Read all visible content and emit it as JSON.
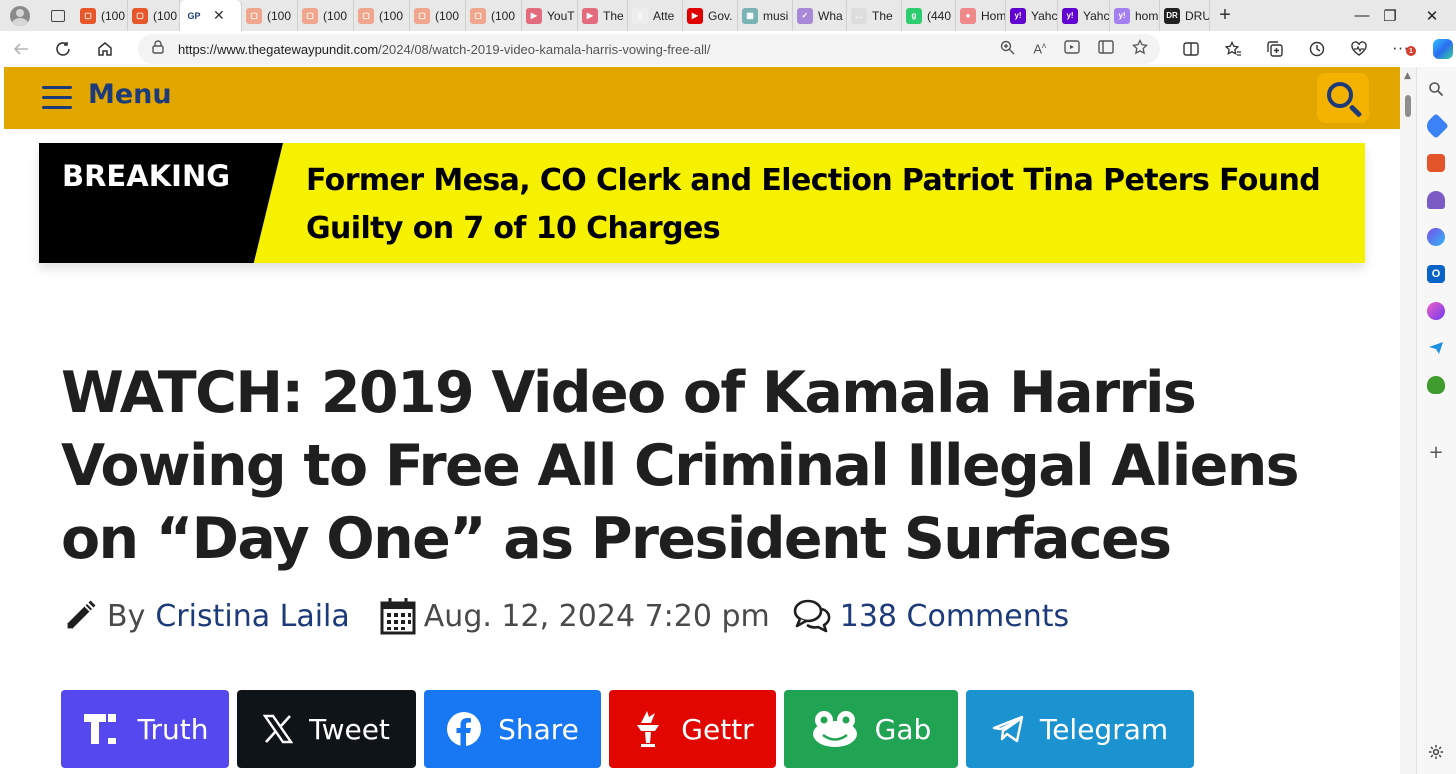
{
  "browser": {
    "tabs": [
      {
        "label": "(100",
        "color": "#e8572b",
        "glyph": "▢"
      },
      {
        "label": "(100",
        "color": "#e8572b",
        "glyph": "▢"
      },
      {
        "label": "GP",
        "color": "#ffffff",
        "glyph": "GP",
        "active": true
      },
      {
        "label": "(100",
        "color": "#f0a58d",
        "glyph": "▢"
      },
      {
        "label": "(100",
        "color": "#f0a58d",
        "glyph": "▢"
      },
      {
        "label": "(100",
        "color": "#f0a58d",
        "glyph": "▢"
      },
      {
        "label": "(100",
        "color": "#f0a58d",
        "glyph": "▢"
      },
      {
        "label": "(100",
        "color": "#f0a58d",
        "glyph": "▢"
      },
      {
        "label": "YouT",
        "color": "#e36b7e",
        "glyph": "▶"
      },
      {
        "label": "The",
        "color": "#e36b7e",
        "glyph": "▶"
      },
      {
        "label": "Atte",
        "color": "#eeeeee",
        "glyph": "▯"
      },
      {
        "label": "Gov.",
        "color": "#e00000",
        "glyph": "▶"
      },
      {
        "label": "musi",
        "color": "#7ab3b3",
        "glyph": "▦"
      },
      {
        "label": "Wha",
        "color": "#a889d8",
        "glyph": "✓"
      },
      {
        "label": "The",
        "color": "#dddddd",
        "glyph": "…"
      },
      {
        "label": "(440",
        "color": "#2ecc71",
        "glyph": "g"
      },
      {
        "label": "Hom",
        "color": "#f08a8a",
        "glyph": "●"
      },
      {
        "label": "Yahc",
        "color": "#6001d2",
        "glyph": "y!"
      },
      {
        "label": "Yahc",
        "color": "#6001d2",
        "glyph": "y!"
      },
      {
        "label": "hom",
        "color": "#a47ff0",
        "glyph": "y!"
      },
      {
        "label": "DRU",
        "color": "#222222",
        "glyph": "DR"
      }
    ],
    "active_close": "✕",
    "new_tab": "+",
    "window": {
      "minimize": "—",
      "restore": "❐",
      "close": "✕"
    },
    "url_domain": "https://www.thegatewaypundit.com",
    "url_path": "/2024/08/watch-2019-video-kamala-harris-vowing-free-all/",
    "notification_count": "1"
  },
  "site": {
    "menu_label": "Menu",
    "breaking_label": "BREAKING",
    "breaking_headline": "Former Mesa, CO Clerk and Election Patriot Tina Peters Found Guilty on 7 of 10 Charges"
  },
  "article": {
    "title": "WATCH: 2019 Video of Kamala Harris Vowing to Free All Criminal Illegal Aliens on “Day One” as President Surfaces",
    "by": "By",
    "author": "Cristina Laila",
    "date": "Aug. 12, 2024 7:20 pm",
    "comments": "138 Comments"
  },
  "share_buttons": [
    {
      "label": "Truth",
      "color": "#5448ee",
      "icon": "truth-icon"
    },
    {
      "label": "Tweet",
      "color": "#0f1419",
      "icon": "x-icon"
    },
    {
      "label": "Share",
      "color": "#1877f2",
      "icon": "facebook-icon"
    },
    {
      "label": "Gettr",
      "color": "#e10600",
      "icon": "gettr-icon"
    },
    {
      "label": "Gab",
      "color": "#21a354",
      "icon": "gab-icon"
    },
    {
      "label": "Telegram",
      "color": "#1c93d1",
      "icon": "telegram-icon"
    }
  ]
}
